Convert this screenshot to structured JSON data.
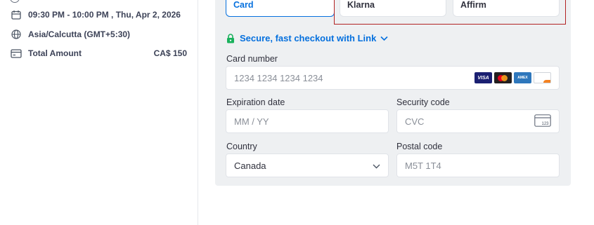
{
  "summary": {
    "datetime": "09:30 PM - 10:00 PM , Thu, Apr 2, 2026",
    "timezone": "Asia/Calcutta (GMT+5:30)",
    "total_label": "Total Amount",
    "total_value": "CA$ 150"
  },
  "payment": {
    "tabs": [
      "Card",
      "Klarna",
      "Affirm"
    ],
    "link_text": "Secure, fast checkout with Link",
    "card_number": {
      "label": "Card number",
      "placeholder": "1234 1234 1234 1234"
    },
    "card_brands": [
      "VISA",
      "mastercard",
      "AMEX",
      "DISCOVER"
    ],
    "expiration": {
      "label": "Expiration date",
      "placeholder": "MM / YY"
    },
    "security": {
      "label": "Security code",
      "placeholder": "CVC",
      "icon_text": "123"
    },
    "country": {
      "label": "Country",
      "value": "Canada"
    },
    "postal": {
      "label": "Postal code",
      "placeholder": "M5T 1T4"
    }
  },
  "colors": {
    "accent": "#0570de",
    "highlight": "#b22222",
    "panel": "#eef0f2"
  },
  "icons": [
    "calendar-icon",
    "globe-icon",
    "credit-card-icon",
    "lock-icon",
    "chevron-down-icon"
  ]
}
